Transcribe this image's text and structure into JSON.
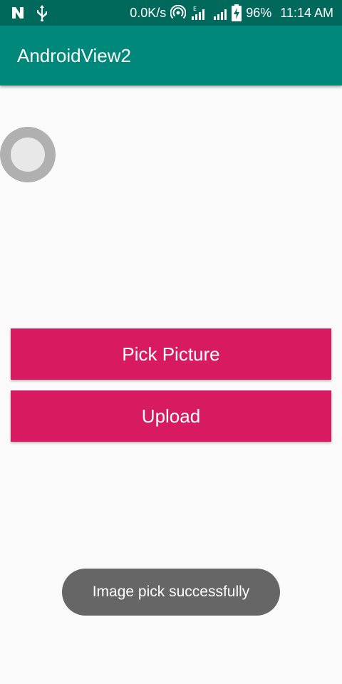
{
  "status_bar": {
    "network_speed": "0.0K/s",
    "network_type": "E",
    "battery": "96%",
    "time": "11:14 AM",
    "icons": [
      "n-notification-icon",
      "usb-icon",
      "hotspot-icon",
      "signal-icon",
      "signal-icon-2",
      "battery-charging-icon"
    ]
  },
  "app_bar": {
    "title": "AndroidView2"
  },
  "image_view": {
    "icon": "image-placeholder-icon"
  },
  "buttons": {
    "pick_label": "Pick Picture",
    "upload_label": "Upload"
  },
  "toast": {
    "message": "Image pick successfully"
  },
  "colors": {
    "status_bar": "#00695c",
    "app_bar": "#00897b",
    "accent_button": "#d81b60",
    "toast_bg": "#666666",
    "background": "#fafafa"
  }
}
